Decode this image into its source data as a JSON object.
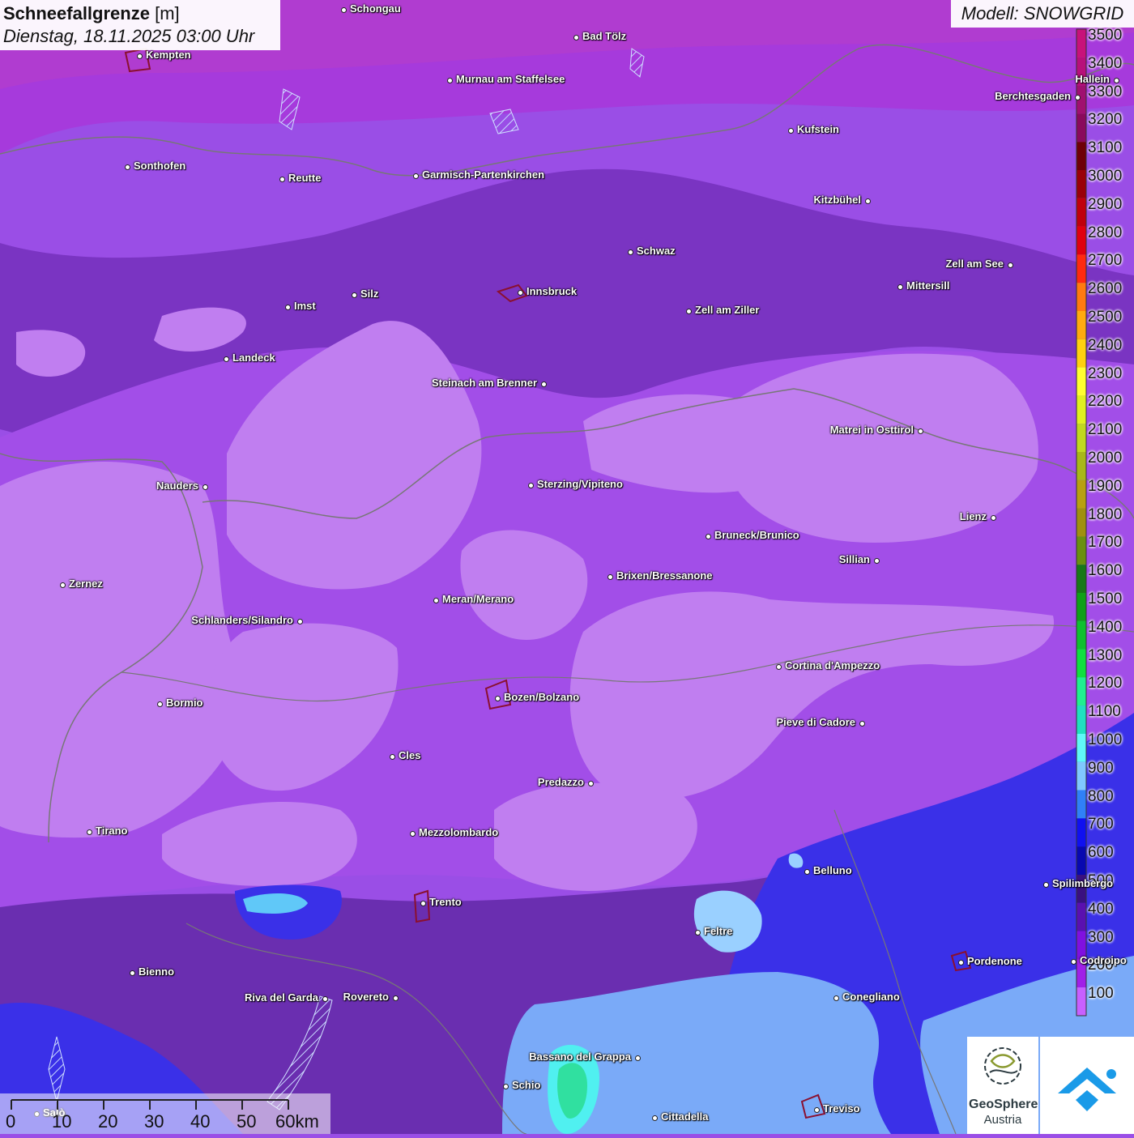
{
  "header": {
    "title_bold": "Schneefallgrenze",
    "title_unit": "[m]",
    "datetime": "Dienstag, 18.11.2025 03:00 Uhr",
    "model": "Modell: SNOWGRID"
  },
  "legend": {
    "levels": [
      "3500",
      "3400",
      "3300",
      "3200",
      "3100",
      "3000",
      "2900",
      "2800",
      "2700",
      "2600",
      "2500",
      "2400",
      "2300",
      "2200",
      "2100",
      "2000",
      "1900",
      "1800",
      "1700",
      "1600",
      "1500",
      "1400",
      "1300",
      "1200",
      "1100",
      "1000",
      "900",
      "800",
      "700",
      "600",
      "500",
      "400",
      "300",
      "200",
      "100"
    ],
    "colors": [
      "#c8127a",
      "#b8107a",
      "#a01070",
      "#8a0a5c",
      "#6e0008",
      "#9a0008",
      "#c0000c",
      "#e00010",
      "#ff2a10",
      "#ff7a10",
      "#ffaa10",
      "#ffd010",
      "#ffff30",
      "#e0f020",
      "#c0d820",
      "#a8b818",
      "#b8a010",
      "#a09010",
      "#6a9010",
      "#187818",
      "#10a018",
      "#10c030",
      "#10e040",
      "#20f090",
      "#20e0c0",
      "#60f8f8",
      "#80c8ff",
      "#3080f8",
      "#1010f0",
      "#0808b0",
      "#3a1080",
      "#5a10b0",
      "#8010e0",
      "#a020e8",
      "#c860ff"
    ]
  },
  "cities": [
    {
      "name": "Schongau"
    },
    {
      "name": "Bad Tölz"
    },
    {
      "name": "Kempten"
    },
    {
      "name": "Murnau am Staffelsee"
    },
    {
      "name": "Hallein"
    },
    {
      "name": "Berchtesgaden"
    },
    {
      "name": "Kufstein"
    },
    {
      "name": "Sonthofen"
    },
    {
      "name": "Reutte"
    },
    {
      "name": "Garmisch-Partenkirchen"
    },
    {
      "name": "Kitzbühel"
    },
    {
      "name": "Schwaz"
    },
    {
      "name": "Zell am See"
    },
    {
      "name": "Mittersill"
    },
    {
      "name": "Innsbruck"
    },
    {
      "name": "Silz"
    },
    {
      "name": "Imst"
    },
    {
      "name": "Zell am Ziller"
    },
    {
      "name": "Landeck"
    },
    {
      "name": "Steinach am Brenner"
    },
    {
      "name": "Matrei in Osttirol"
    },
    {
      "name": "Nauders"
    },
    {
      "name": "Sterzing/Vipiteno"
    },
    {
      "name": "Lienz"
    },
    {
      "name": "Bruneck/Brunico"
    },
    {
      "name": "Sillian"
    },
    {
      "name": "Brixen/Bressanone"
    },
    {
      "name": "Zernez"
    },
    {
      "name": "Meran/Merano"
    },
    {
      "name": "Schlanders/Silandro"
    },
    {
      "name": "Cortina d'Ampezzo"
    },
    {
      "name": "Bozen/Bolzano"
    },
    {
      "name": "Bormio"
    },
    {
      "name": "Pieve di Cadore"
    },
    {
      "name": "Cles"
    },
    {
      "name": "Predazzo"
    },
    {
      "name": "Tirano"
    },
    {
      "name": "Mezzolombardo"
    },
    {
      "name": "Belluno"
    },
    {
      "name": "Spilimbergo"
    },
    {
      "name": "Trento"
    },
    {
      "name": "Feltre"
    },
    {
      "name": "Pordenone"
    },
    {
      "name": "Codroipo"
    },
    {
      "name": "Bienno"
    },
    {
      "name": "Riva del Garda"
    },
    {
      "name": "Rovereto"
    },
    {
      "name": "Conegliano"
    },
    {
      "name": "Bassano del Grappa"
    },
    {
      "name": "Schio"
    },
    {
      "name": "Treviso"
    },
    {
      "name": "Cittadella"
    },
    {
      "name": "Salò"
    }
  ],
  "scalebar": {
    "labels": [
      "0",
      "10",
      "20",
      "30",
      "40",
      "50",
      "60km"
    ]
  },
  "logos": {
    "geosphere_line1": "GeoSphere",
    "geosphere_line2": "Austria"
  }
}
